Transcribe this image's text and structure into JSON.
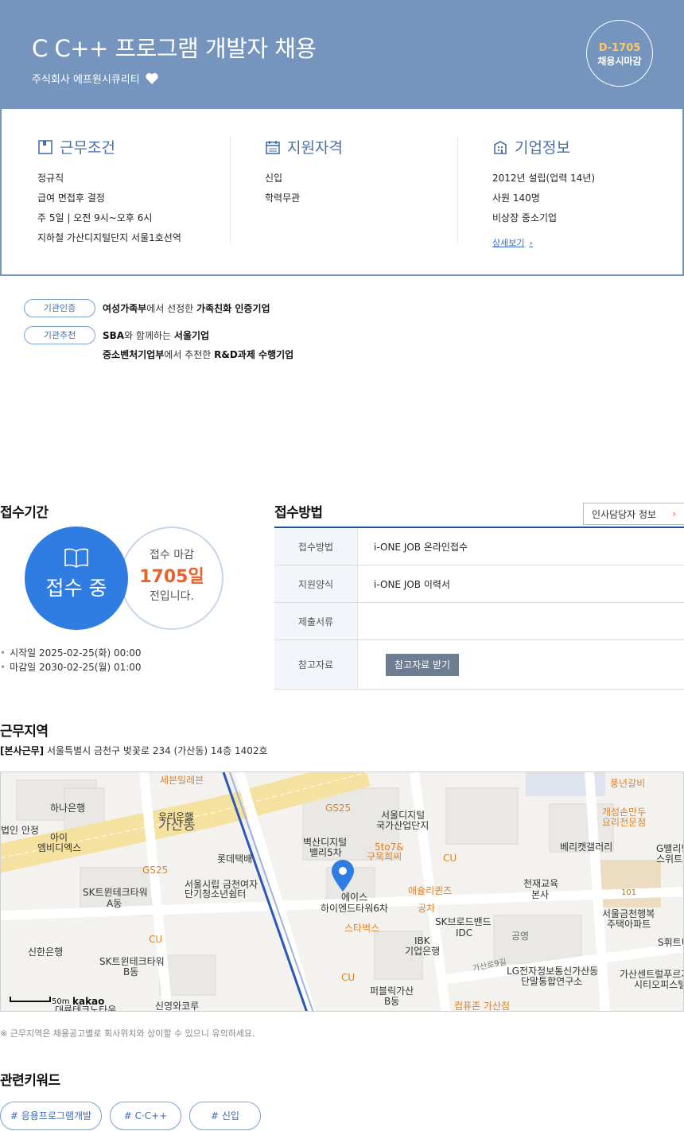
{
  "header": {
    "title": "C C++ 프로그램 개발자 채용",
    "company": "주식회사 에프원시큐리티",
    "dday": "D-1705",
    "deadline_label": "채용시마감"
  },
  "summary": {
    "work": {
      "title": "근무조건",
      "items": [
        "정규직",
        "급여 면접후 결정",
        "주 5일 | 오전 9시~오후 6시",
        "지하철 가산디지털단지 서울1호선역"
      ]
    },
    "qualify": {
      "title": "지원자격",
      "items": [
        "신입",
        "학력무관"
      ]
    },
    "company": {
      "title": "기업정보",
      "items": [
        "2012년 설립(업력 14년)",
        "사원 140명",
        "비상장 중소기업"
      ],
      "more": "상세보기"
    }
  },
  "certifications": [
    {
      "badge": "기관인증",
      "lines": [
        [
          {
            "t": "여성가족부",
            "b": true
          },
          {
            "t": "에서 선정한 ",
            "b": false
          },
          {
            "t": "가족친화 인증기업",
            "b": true
          }
        ]
      ]
    },
    {
      "badge": "기관추천",
      "lines": [
        [
          {
            "t": "SBA",
            "b": true
          },
          {
            "t": "와 함께하는 ",
            "b": false
          },
          {
            "t": "서울기업",
            "b": true
          }
        ],
        [
          {
            "t": "중소벤처기업부",
            "b": true
          },
          {
            "t": "에서 추천한 ",
            "b": false
          },
          {
            "t": "R&D과제 수행기업",
            "b": true
          }
        ]
      ]
    }
  ],
  "period": {
    "title": "접수기간",
    "status": "접수 중",
    "sub_top": "접수 마감",
    "sub_days": "1705일",
    "sub_bottom": "전입니다.",
    "start": "시작일 2025-02-25(화) 00:00",
    "end": "마감일 2030-02-25(월) 01:00"
  },
  "method": {
    "title": "접수방법",
    "contact_button": "인사담당자 정보",
    "rows": [
      {
        "key": "접수방법",
        "value": "i-ONE JOB 온라인접수"
      },
      {
        "key": "지원양식",
        "value": "i-ONE JOB 이력서"
      },
      {
        "key": "제출서류",
        "value": ""
      },
      {
        "key": "참고자료",
        "button": "참고자료 받기"
      }
    ]
  },
  "location": {
    "title": "근무지역",
    "tag": "[본사근무]",
    "address": " 서울특별시 금천구 벚꽃로 234 (가산동) 14층 1402호",
    "note": "※ 근무지역은 채용공고별로 회사위치와 상이할 수 있으니 유의하세요.",
    "map_labels": [
      "세븐일레븐",
      "GS25",
      "하나은행",
      "우리은행",
      "가산동",
      "서울디지털 국가산업단지",
      "벽산디지털 밸리5차",
      "5to7& 구욱희씨",
      "CU",
      "풍년갈비",
      "개성손만두 요리전문점",
      "베리캣갤러리",
      "G밸리닝 스위트",
      "법인 안정",
      "아이 엠비디엑스",
      "롯데택배",
      "서울시립 금천여자 단기청소년쉼터",
      "SK트윈테크타워 A동",
      "GS25",
      "에이스 하이엔드타워6차",
      "애슐리퀸즈",
      "천재교육 본사",
      "101",
      "서울금천행복 주택아파트",
      "공차",
      "스타벅스",
      "SK브로드밴드 IDC",
      "IBK 기업은행",
      "공영",
      "가산로9길",
      "LG전자정보통신가산동 단말통합연구소",
      "S휘트니",
      "가산센트럴푸르지 시티오피스텔",
      "신한은행",
      "CU",
      "SK트윈테크타워 B동",
      "퍼블릭가산 B동",
      "컴퓨존 가산점",
      "신영와코루",
      "대륭테크노타운",
      "50m",
      "kakao"
    ]
  },
  "keywords": {
    "title": "관련키워드",
    "items": [
      "# 응용프로그램개발",
      "# C·C++",
      "# 신입"
    ]
  }
}
